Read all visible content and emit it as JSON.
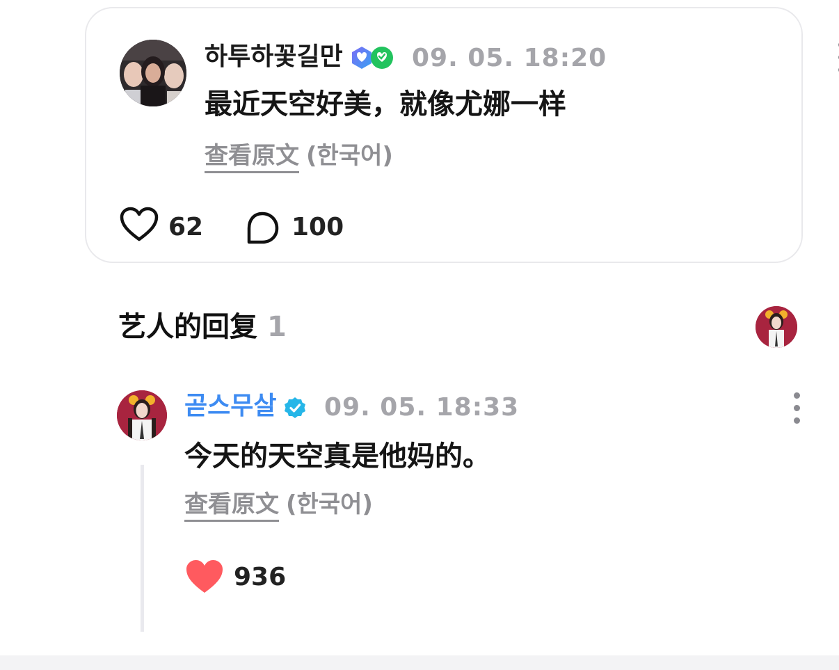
{
  "post": {
    "author": "하투하꽃길만",
    "timestamp": "09. 05. 18:20",
    "text": "最近天空好美，就像尤娜一样",
    "translate_label": "查看原文",
    "translate_lang": "(한국어)",
    "like_count": "62",
    "comment_count": "100",
    "icons": {
      "avatar": "user-photo-avatar",
      "badges": [
        "membership-badge-icon",
        "fan-badge-icon"
      ],
      "menu": "more-vertical-icon",
      "like": "heart-outline-icon",
      "comment": "speech-bubble-icon"
    }
  },
  "artist_replies": {
    "title": "艺人的回复",
    "count": "1",
    "icons": {
      "avatar": "artist-avatar"
    }
  },
  "reply": {
    "author": "곧스무살",
    "timestamp": "09. 05. 18:33",
    "text": "今天的天空真是他妈的。",
    "translate_label": "查看原文",
    "translate_lang": "(한국어)",
    "like_count": "936",
    "icons": {
      "avatar": "artist-avatar",
      "verified": "verified-check-icon",
      "menu": "more-vertical-icon",
      "like": "heart-filled-icon"
    }
  },
  "colors": {
    "artist_name": "#3d8bf2",
    "liked_heart": "#ff5a5f",
    "muted_text": "#a5a5aa",
    "card_border": "#e9e9ec",
    "verified_badge": "#26b6e8"
  }
}
